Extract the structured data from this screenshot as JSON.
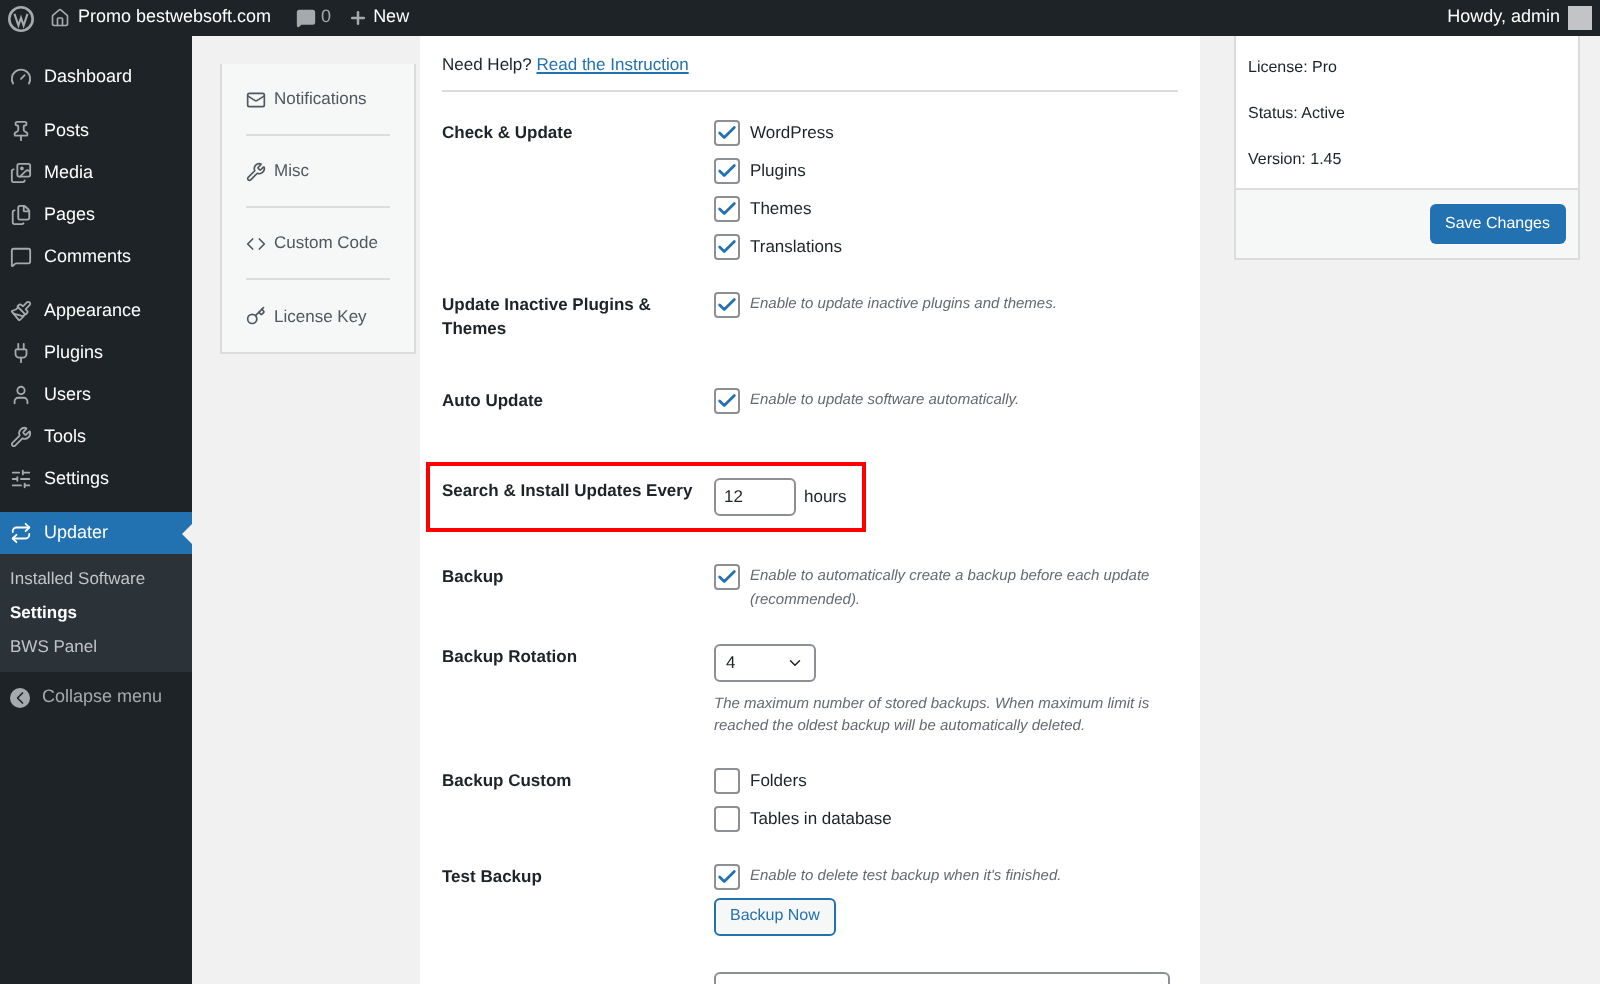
{
  "admin_bar": {
    "site": "Promo bestwebsoft.com",
    "comments": "0",
    "new": "New",
    "greeting": "Howdy, admin"
  },
  "sidebar": {
    "items": [
      {
        "label": "Dashboard",
        "selected": false
      },
      {
        "label": "Posts",
        "selected": false
      },
      {
        "label": "Media",
        "selected": false
      },
      {
        "label": "Pages",
        "selected": false
      },
      {
        "label": "Comments",
        "selected": false
      },
      {
        "label": "Appearance",
        "selected": false
      },
      {
        "label": "Plugins",
        "selected": false
      },
      {
        "label": "Users",
        "selected": false
      },
      {
        "label": "Tools",
        "selected": false
      },
      {
        "label": "Settings",
        "selected": false
      },
      {
        "label": "Updater",
        "selected": true
      }
    ],
    "submenu": [
      {
        "label": "Installed Software",
        "selected": false
      },
      {
        "label": "Settings",
        "selected": true
      },
      {
        "label": "BWS Panel",
        "selected": false
      }
    ],
    "collapse": "Collapse menu"
  },
  "tabs": [
    {
      "label": "Notifications"
    },
    {
      "label": "Misc"
    },
    {
      "label": "Custom Code"
    },
    {
      "label": "License Key"
    }
  ],
  "help": {
    "text": "Need Help?",
    "link": "Read the Instruction"
  },
  "settings": [
    {
      "kind": "checklist",
      "label": "Check & Update",
      "options": [
        {
          "label": "WordPress",
          "checked": true
        },
        {
          "label": "Plugins",
          "checked": true
        },
        {
          "label": "Themes",
          "checked": true
        },
        {
          "label": "Translations",
          "checked": true
        }
      ]
    },
    {
      "kind": "checkbox",
      "label": "Update Inactive Plugins & Themes",
      "checked": true,
      "description": "Enable to update inactive plugins and themes."
    },
    {
      "kind": "checkbox",
      "label": "Auto Update",
      "checked": true,
      "description": "Enable to update software automatically."
    },
    {
      "kind": "number",
      "label": "Search & Install Updates Every",
      "value": "12",
      "unit": "hours",
      "highlighted": true
    },
    {
      "kind": "checkbox",
      "label": "Backup",
      "checked": true,
      "description": "Enable to automatically create a backup before each update (recommended)."
    },
    {
      "kind": "select",
      "label": "Backup Rotation",
      "value": "4",
      "description": "The maximum number of stored backups. When maximum limit is reached the oldest backup will be automatically deleted."
    },
    {
      "kind": "checklist",
      "label": "Backup Custom",
      "options": [
        {
          "label": "Folders",
          "checked": false
        },
        {
          "label": "Tables in database",
          "checked": false
        }
      ]
    },
    {
      "kind": "checkbox",
      "label": "Test Backup",
      "checked": true,
      "description": "Enable to delete test backup when it's finished.",
      "button": "Backup Now"
    }
  ],
  "license": {
    "license": "License: Pro",
    "status": "Status: Active",
    "version": "Version: 1.45",
    "save": "Save Changes"
  }
}
